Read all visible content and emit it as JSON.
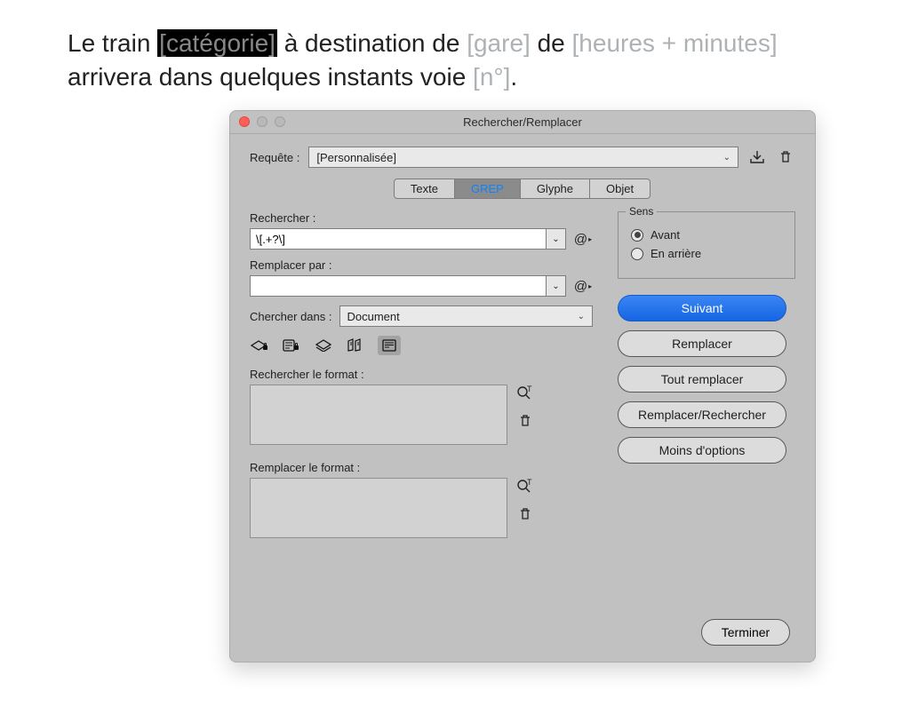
{
  "document": {
    "t1": "Le train ",
    "ph1": "[catégorie]",
    "t2": " à destination de ",
    "ph2": "[gare]",
    "t3": " de ",
    "ph3": "[heures + minutes]",
    "t4": " arrivera dans quelques instants voie ",
    "ph4": "[n°]",
    "t5": "."
  },
  "dialog": {
    "title": "Rechercher/Remplacer",
    "query_label": "Requête :",
    "query_value": "[Personnalisée]",
    "tabs": {
      "text": "Texte",
      "grep": "GREP",
      "glyph": "Glyphe",
      "object": "Objet"
    },
    "find_label": "Rechercher :",
    "find_value": "\\[.+?\\]",
    "replace_label": "Remplacer par :",
    "replace_value": "",
    "scope_label": "Chercher dans :",
    "scope_value": "Document",
    "find_format_label": "Rechercher le format :",
    "replace_format_label": "Remplacer le format :",
    "sense": {
      "legend": "Sens",
      "forward": "Avant",
      "backward": "En arrière"
    },
    "buttons": {
      "next": "Suivant",
      "replace": "Remplacer",
      "replace_all": "Tout remplacer",
      "replace_find": "Remplacer/Rechercher",
      "fewer": "Moins d'options",
      "done": "Terminer"
    }
  }
}
